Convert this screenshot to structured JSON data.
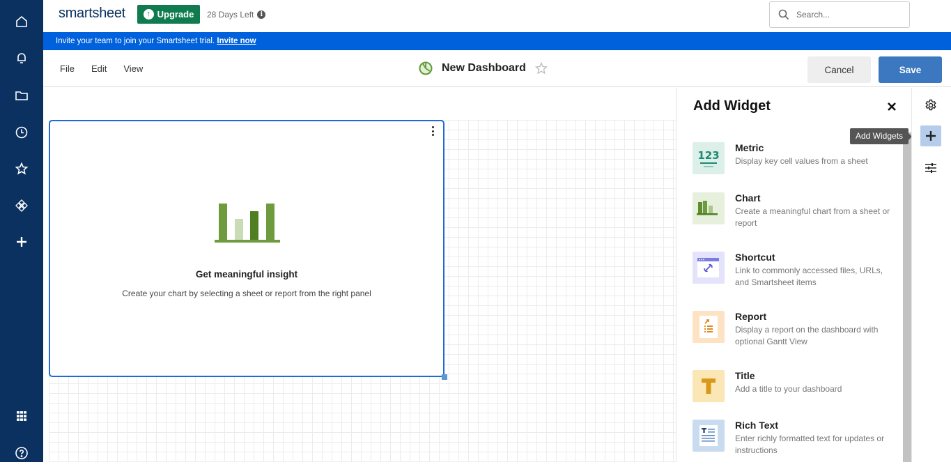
{
  "app": {
    "logo": "smartsheet",
    "upgrade_label": "Upgrade",
    "trial_status": "28 Days Left"
  },
  "search": {
    "placeholder": "Search...",
    "value": ""
  },
  "banner": {
    "message": "Invite your team to join your Smartsheet trial.",
    "link_label": "Invite now"
  },
  "left_rail": {
    "items": [
      {
        "icon": "home-icon",
        "label": "Home"
      },
      {
        "icon": "bell-icon",
        "label": "Notifications"
      },
      {
        "icon": "folder-icon",
        "label": "Browse"
      },
      {
        "icon": "clock-icon",
        "label": "Recents"
      },
      {
        "icon": "star-icon",
        "label": "Favorites"
      },
      {
        "icon": "solutions-icon",
        "label": "Solution Center"
      },
      {
        "icon": "plus-icon",
        "label": "Create"
      }
    ],
    "bottom": [
      {
        "icon": "apps-grid-icon",
        "label": "Launcher"
      },
      {
        "icon": "help-icon",
        "label": "Help"
      }
    ]
  },
  "toolbar": {
    "menu": [
      "File",
      "Edit",
      "View"
    ],
    "dashboard_name": "New Dashboard",
    "cancel_label": "Cancel",
    "save_label": "Save"
  },
  "widget": {
    "title": "Get meaningful insight",
    "description": "Create your chart by selecting a sheet or report from the right panel"
  },
  "panel": {
    "title": "Add Widget",
    "items": [
      {
        "name": "Metric",
        "description": "Display key cell values from a sheet",
        "icon": "metric-icon",
        "icon_text": "123",
        "bg": "#dcefe9"
      },
      {
        "name": "Chart",
        "description": "Create a meaningful chart from a sheet or report",
        "icon": "chart-icon",
        "bg": "#e6f0dd"
      },
      {
        "name": "Shortcut",
        "description": "Link to commonly accessed files, URLs, and Smartsheet items",
        "icon": "shortcut-icon",
        "bg": "#e4e3fb"
      },
      {
        "name": "Report",
        "description": "Display a report on the dashboard with optional Gantt View",
        "icon": "report-icon",
        "bg": "#fde3c4"
      },
      {
        "name": "Title",
        "description": "Add a title to your dashboard",
        "icon": "title-icon",
        "icon_text": "T",
        "bg": "#fbe6b5"
      },
      {
        "name": "Rich Text",
        "description": "Enter richly formatted text for updates or instructions",
        "icon": "rich-text-icon",
        "bg": "#c9dcef"
      }
    ]
  },
  "right_rail": {
    "items": [
      {
        "icon": "gear-icon",
        "label": "Settings"
      },
      {
        "icon": "plus-icon",
        "label": "Add Widgets",
        "active": true
      },
      {
        "icon": "sliders-icon",
        "label": "Format"
      }
    ],
    "tooltip": "Add Widgets"
  },
  "colors": {
    "rail_bg": "#0b3160",
    "banner_bg": "#0061dc",
    "upgrade_bg": "#0f7b4f",
    "save_bg": "#3b78c0",
    "widget_border": "#1d6ad8",
    "chart_green": "#6f9b3f"
  }
}
